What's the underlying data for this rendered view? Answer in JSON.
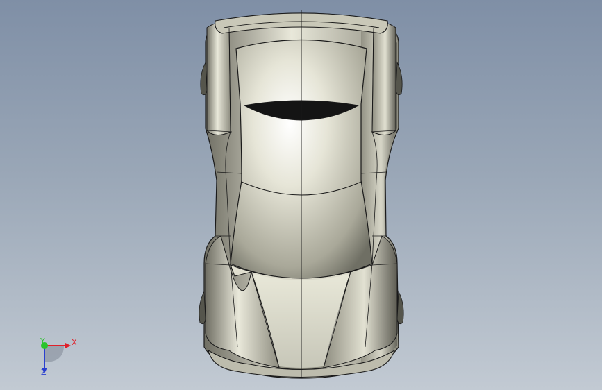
{
  "viewport": {
    "background_top": "#7f8fa6",
    "background_bottom": "#c2cad3"
  },
  "model": {
    "name_icon": "car-body-top-view",
    "body_color": "#d7d6c4",
    "edge_color": "#1a1a1a"
  },
  "triad": {
    "x_label": "X",
    "y_label": "Y",
    "z_label": "Z",
    "x_color": "#e0202a",
    "y_color": "#2bc42b",
    "z_color": "#2a3fcf"
  }
}
